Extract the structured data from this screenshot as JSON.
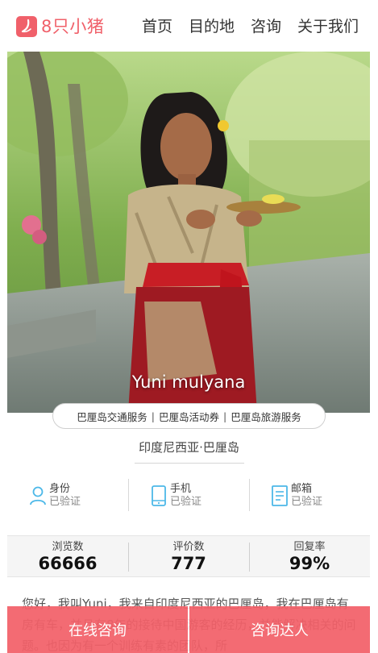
{
  "header": {
    "logo_text": "8只小猪",
    "nav": [
      "首页",
      "目的地",
      "咨询",
      "关于我们"
    ]
  },
  "hero": {
    "guide_name": "Yuni mulyana"
  },
  "tags": [
    "巴厘岛交通服务",
    "巴厘岛活动券",
    "巴厘岛旅游服务"
  ],
  "location": "印度尼西亚·巴厘岛",
  "verification": [
    {
      "label": "身份",
      "status": "已验证",
      "icon": "person-icon"
    },
    {
      "label": "手机",
      "status": "已验证",
      "icon": "phone-icon"
    },
    {
      "label": "邮箱",
      "status": "已验证",
      "icon": "document-icon"
    }
  ],
  "stats": [
    {
      "label": "浏览数",
      "value": "66666"
    },
    {
      "label": "评价数",
      "value": "777"
    },
    {
      "label": "回复率",
      "value": "99%"
    }
  ],
  "bio": "您好，我叫Yuni，我来自印度尼西亚的巴厘岛，我在巴厘岛有房有车，并且有8年的接待中国游客的经历，并能解决相关的问题。也因为有一个训练有素的团队，所",
  "bottom_bar": {
    "online_consult": "在线咨询",
    "consult_expert": "咨询达人"
  },
  "colors": {
    "brand": "#f0606a",
    "icon_blue": "#4cb8e8"
  }
}
